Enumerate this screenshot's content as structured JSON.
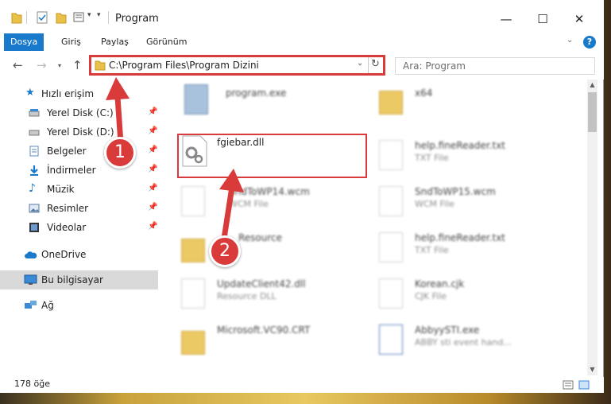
{
  "window": {
    "title": "Program",
    "controls": {
      "minimize": "—",
      "maximize": "☐",
      "close": "✕"
    }
  },
  "ribbon": {
    "tabs": [
      {
        "label": "Dosya"
      },
      {
        "label": "Giriş"
      },
      {
        "label": "Paylaş"
      },
      {
        "label": "Görünüm"
      }
    ]
  },
  "nav": {
    "address": "C:\\Program Files\\Program Dizini",
    "search_placeholder": "Ara: Program"
  },
  "sidebar": {
    "items": [
      {
        "label": "Hızlı erişim",
        "icon": "star-icon"
      },
      {
        "label": "Yerel Disk (C:)",
        "icon": "drive-icon"
      },
      {
        "label": "Yerel Disk (D:)",
        "icon": "drive-icon"
      },
      {
        "label": "Belgeler",
        "icon": "documents-icon"
      },
      {
        "label": "İndirmeler",
        "icon": "download-icon"
      },
      {
        "label": "Müzik",
        "icon": "music-icon"
      },
      {
        "label": "Resimler",
        "icon": "pictures-icon"
      },
      {
        "label": "Videolar",
        "icon": "video-icon"
      },
      {
        "label": "OneDrive",
        "icon": "cloud-icon"
      },
      {
        "label": "Bu bilgisayar",
        "icon": "computer-icon"
      },
      {
        "label": "Ağ",
        "icon": "network-icon"
      }
    ]
  },
  "files": [
    {
      "name": "program.exe",
      "type": ""
    },
    {
      "name": "x64",
      "type": ""
    },
    {
      "name": "fgiebar.dll",
      "type": ""
    },
    {
      "name": "help.fineReader.txt",
      "type": "TXT File"
    },
    {
      "name": "SndToWP14.wcm",
      "type": "WCM File"
    },
    {
      "name": "SndToWP15.wcm",
      "type": "WCM File"
    },
    {
      "name": "Resource",
      "type": ""
    },
    {
      "name": "help.fineReader.txt",
      "type": "TXT File"
    },
    {
      "name": "UpdateClient42.dll",
      "type": "Resource DLL"
    },
    {
      "name": "Korean.cjk",
      "type": "CJK File"
    },
    {
      "name": "Microsoft.VC90.CRT",
      "type": ""
    },
    {
      "name": "AbbyySTI.exe",
      "type": "ABBY sti event hand..."
    }
  ],
  "status": {
    "count": "178 öğe"
  },
  "annotations": {
    "step1": "1",
    "step2": "2"
  },
  "colors": {
    "accent": "#1979ca",
    "annotation": "#d93a3a"
  }
}
